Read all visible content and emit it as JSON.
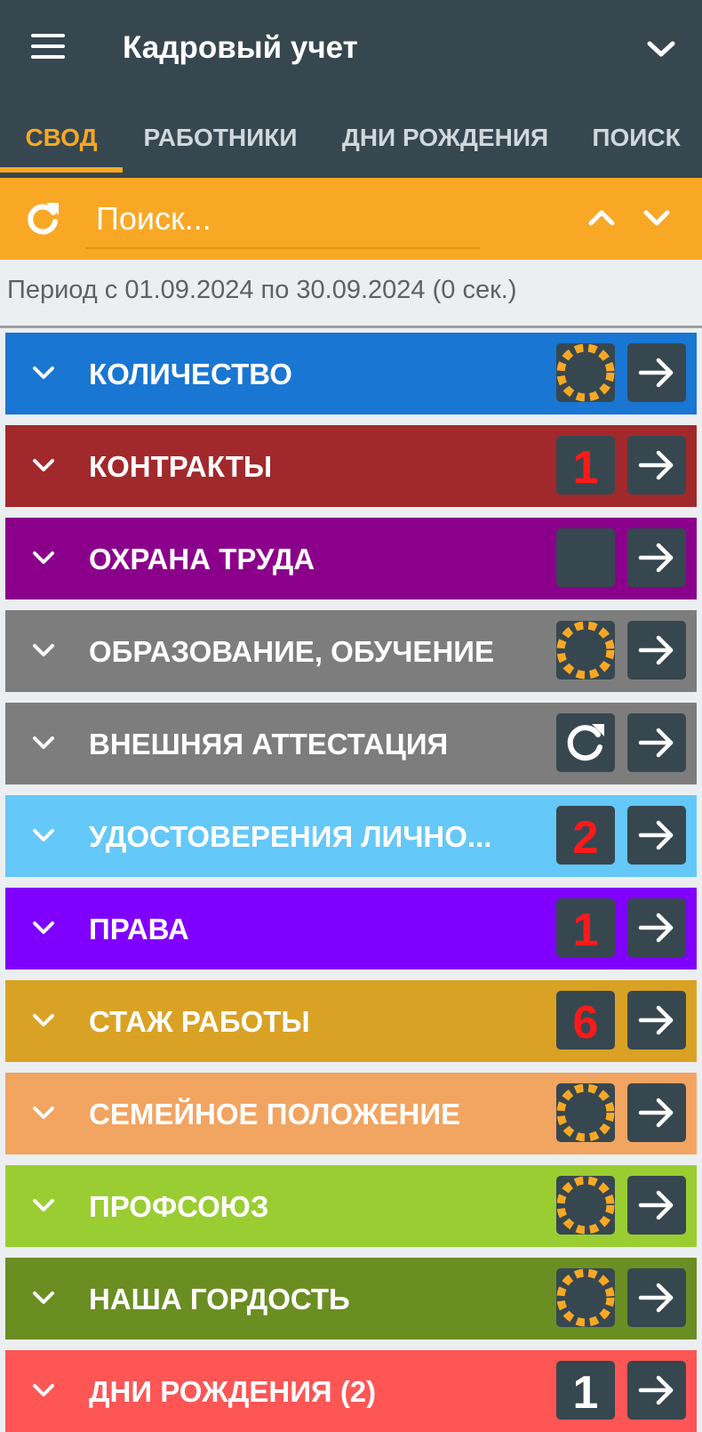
{
  "app": {
    "title": "Кадровый учет"
  },
  "tabs": [
    {
      "label": "СВОД",
      "active": true
    },
    {
      "label": "РАБОТНИКИ",
      "active": false
    },
    {
      "label": "ДНИ РОЖДЕНИЯ",
      "active": false
    },
    {
      "label": "ПОИСК",
      "active": false
    }
  ],
  "search": {
    "placeholder": "Поиск..."
  },
  "period": {
    "text": "Период с 01.09.2024 по 30.09.2024 (0 сек.)"
  },
  "colors": {
    "appbar": "#37474f",
    "accent": "#f9a825",
    "badge_bg": "#37474f",
    "badge_number": "#ff1a1a"
  },
  "rows": [
    {
      "label": "КОЛИЧЕСТВО",
      "color": "#1976d2",
      "badge": {
        "kind": "loading-icon"
      }
    },
    {
      "label": "КОНТРАКТЫ",
      "color": "#a1292b",
      "badge": {
        "kind": "number",
        "value": "1"
      }
    },
    {
      "label": "ОХРАНА ТРУДА",
      "color": "#8b008b",
      "badge": {
        "kind": "empty"
      }
    },
    {
      "label": "ОБРАЗОВАНИЕ, ОБУЧЕНИЕ",
      "color": "#7d7d7d",
      "badge": {
        "kind": "loading-icon"
      }
    },
    {
      "label": "ВНЕШНЯЯ АТТЕСТАЦИЯ",
      "color": "#7d7d7d",
      "badge": {
        "kind": "refresh-icon"
      }
    },
    {
      "label": "УДОСТОВЕРЕНИЯ ЛИЧНО...",
      "color": "#64c8f8",
      "badge": {
        "kind": "number",
        "value": "2"
      }
    },
    {
      "label": "ПРАВА",
      "color": "#8000ff",
      "badge": {
        "kind": "number",
        "value": "1"
      }
    },
    {
      "label": "СТАЖ РАБОТЫ",
      "color": "#d9a224",
      "badge": {
        "kind": "number",
        "value": "6"
      }
    },
    {
      "label": "СЕМЕЙНОЕ ПОЛОЖЕНИЕ",
      "color": "#f2a461",
      "badge": {
        "kind": "loading-icon"
      }
    },
    {
      "label": "ПРОФСОЮЗ",
      "color": "#9acd32",
      "badge": {
        "kind": "loading-icon"
      }
    },
    {
      "label": "НАША ГОРДОСТЬ",
      "color": "#6b8e23",
      "badge": {
        "kind": "loading-icon"
      }
    },
    {
      "label": "ДНИ РОЖДЕНИЯ (2)",
      "color": "#fe5555",
      "badge": {
        "kind": "number",
        "value": "1",
        "text_color": "#ffffff"
      }
    }
  ]
}
